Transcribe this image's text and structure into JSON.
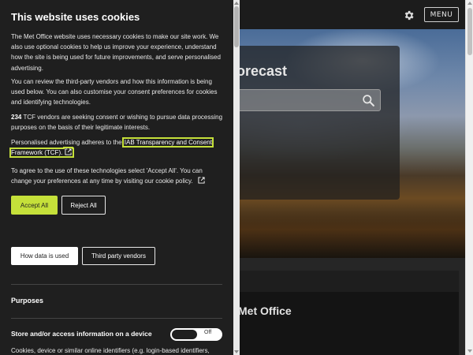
{
  "header": {
    "menu_label": "MENU",
    "settings_icon": "gear-icon"
  },
  "hero": {
    "forecast_title": "orecast",
    "search_icon": "search-icon"
  },
  "card": {
    "title": "Met Office"
  },
  "cookie_panel": {
    "title": "This website uses cookies",
    "paragraph_1": "The Met Office website uses necessary cookies to make our site work. We also use optional cookies to help us improve your experience, understand how the site is being used for future improvements, and serve personalised advertising.",
    "paragraph_2": "You can review the third-party vendors and how this information is being used below. You can also customise your consent preferences for cookies and identifying technologies.",
    "vendor_count": "234",
    "paragraph_3_rest": " TCF vendors are seeking consent or wishing to pursue data processing purposes on the basis of their legitimate interests.",
    "paragraph_4_prefix": "Personalised advertising adheres to the ",
    "tcf_link": "IAB Transparency and Consent Framework (TCF).",
    "paragraph_5": "To agree to the use of these technologies select 'Accept All'. You can change your preferences at any time by visiting our cookie policy.",
    "accept_all": "Accept All",
    "reject_all": "Reject All",
    "how_data_used": "How data is used",
    "third_party_vendors": "Third party vendors",
    "purposes_heading": "Purposes",
    "store_access_label": "Store and/or access information on a device",
    "toggle_state": "Off",
    "paragraph_6": "Cookies, device or similar online identifiers (e.g. login-based identifiers,",
    "accent_color": "#c5e03a"
  }
}
